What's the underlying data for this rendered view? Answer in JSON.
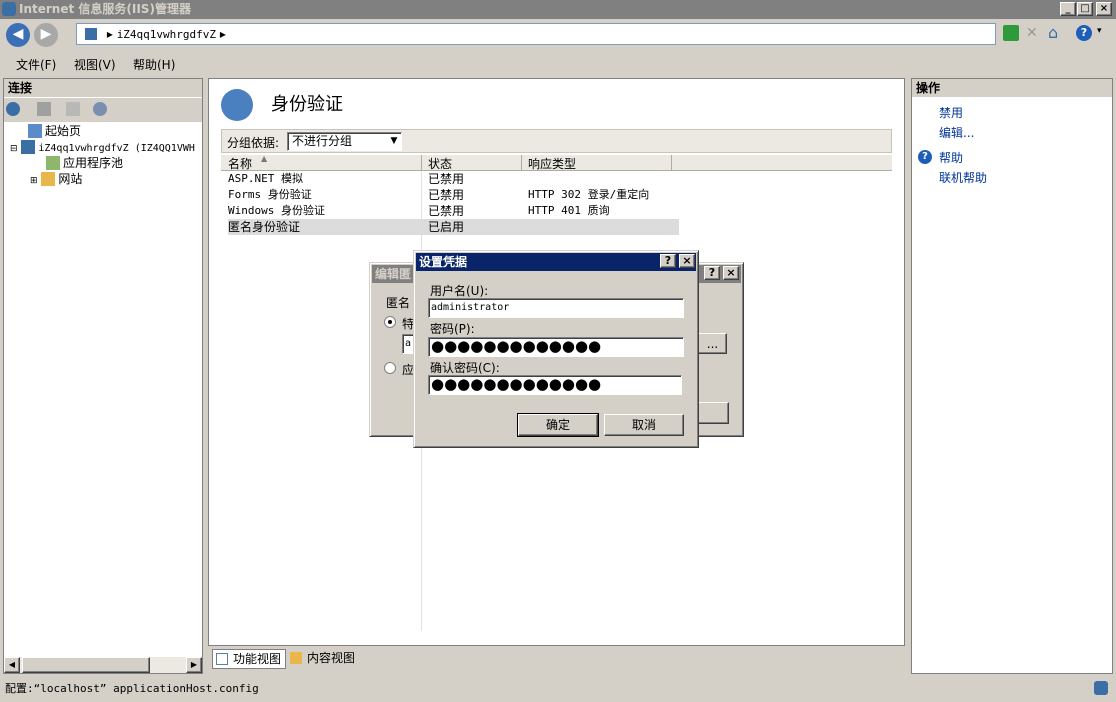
{
  "window": {
    "title": "Internet 信息服务(IIS)管理器"
  },
  "address": {
    "path": "iZ4qq1vwhrgdfvZ"
  },
  "menu": [
    "文件(F)",
    "视图(V)",
    "帮助(H)"
  ],
  "connections": {
    "title": "连接",
    "tree": [
      "起始页",
      "iZ4qq1vwhrgdfvZ (IZ4QQ1VWH",
      "应用程序池",
      "网站"
    ]
  },
  "feature": {
    "title": "身份验证",
    "group_label": "分组依据:",
    "group_value": "不进行分组",
    "columns": [
      "名称",
      "状态",
      "响应类型"
    ],
    "rows": [
      {
        "name": "ASP.NET 模拟",
        "status": "已禁用",
        "response": ""
      },
      {
        "name": "Forms 身份验证",
        "status": "已禁用",
        "response": "HTTP 302 登录/重定向"
      },
      {
        "name": "Windows 身份验证",
        "status": "已禁用",
        "response": "HTTP 401 质询"
      },
      {
        "name": "匿名身份验证",
        "status": "已启用",
        "response": ""
      }
    ]
  },
  "actions": {
    "title": "操作",
    "items": [
      "禁用",
      "编辑...",
      "帮助",
      "联机帮助"
    ]
  },
  "edit_dialog": {
    "title": "编辑匿",
    "label": "匿名",
    "opt1": "特",
    "opt2": "应",
    "value_fragment": "a",
    "browse": "..."
  },
  "cred_dialog": {
    "title": "设置凭据",
    "user_label": "用户名(U):",
    "user_value": "administrator",
    "pwd_label": "密码(P):",
    "pwd_value": "●●●●●●●●●●●●●",
    "confirm_label": "确认密码(C):",
    "confirm_value": "●●●●●●●●●●●●●",
    "ok": "确定",
    "cancel": "取消"
  },
  "bottom_tabs": [
    "功能视图",
    "内容视图"
  ],
  "status": {
    "text": "配置:“localhost” applicationHost.config"
  },
  "colors": {
    "accent": "#0a246a",
    "link": "#003399",
    "title_inactive": "#808080"
  }
}
